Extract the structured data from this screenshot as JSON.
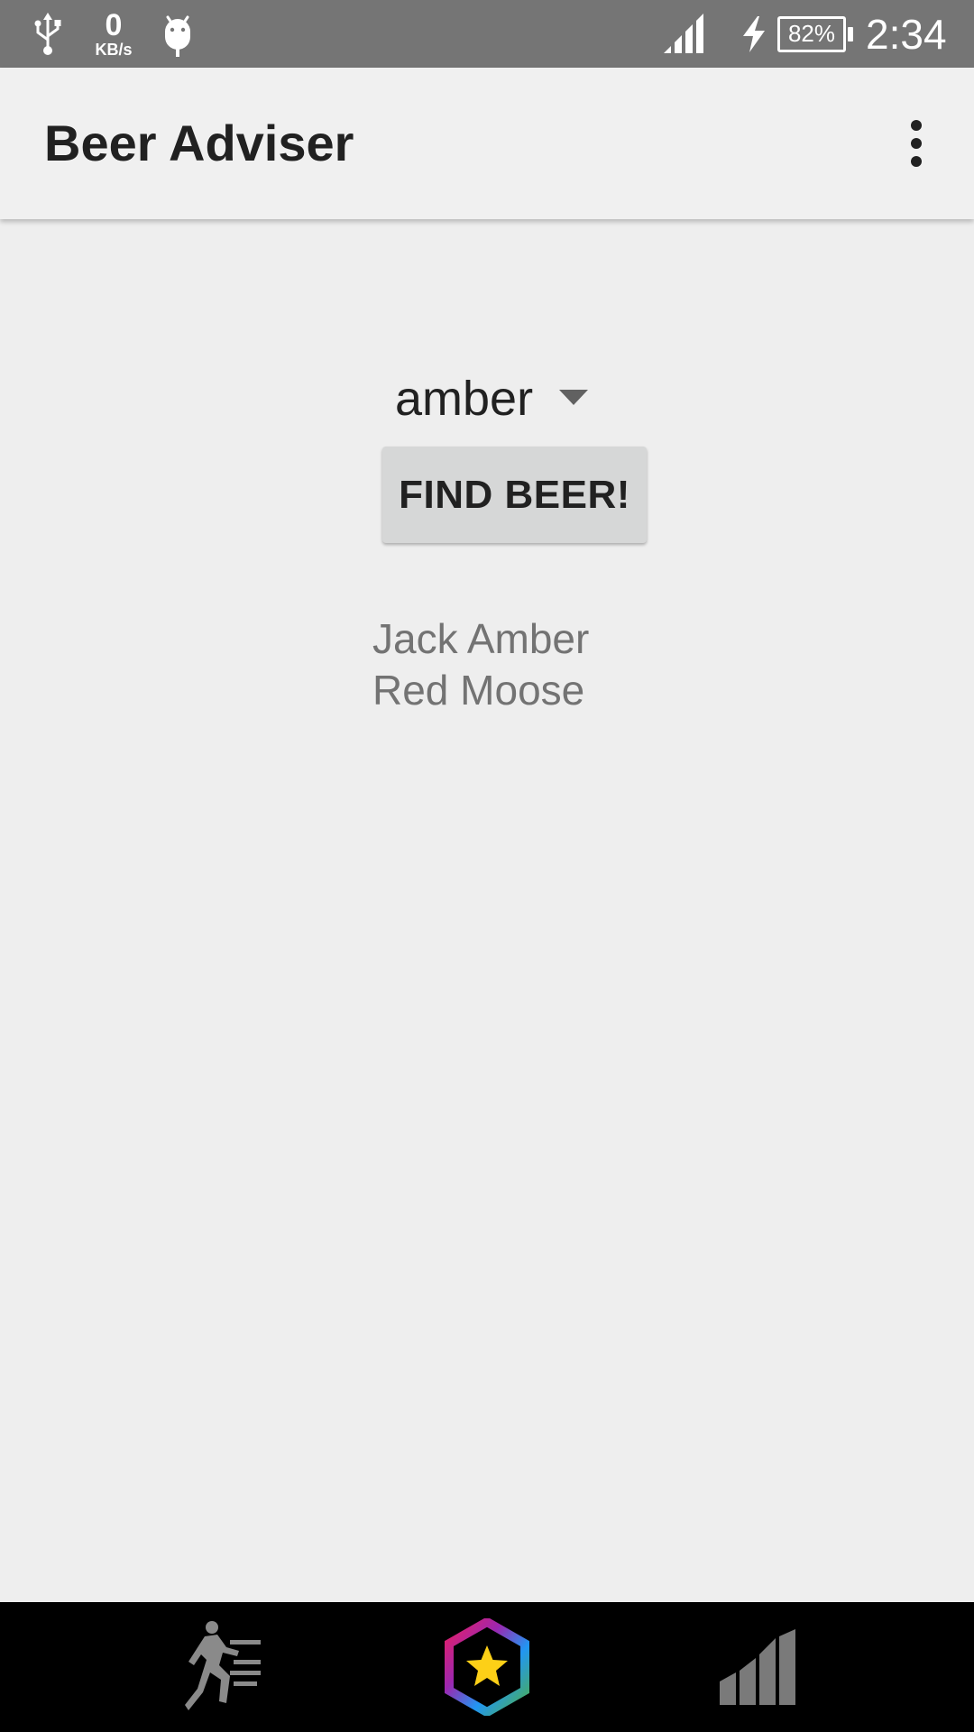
{
  "status_bar": {
    "net_speed_value": "0",
    "net_speed_unit": "KB/s",
    "battery_percent": "82%",
    "time": "2:34",
    "icons": [
      "usb-icon",
      "android-debug-icon",
      "signal-icon",
      "charging-icon",
      "battery-icon"
    ]
  },
  "app_bar": {
    "title": "Beer Adviser",
    "menu_icon": "more-vert-icon"
  },
  "form": {
    "color_spinner_value": "amber",
    "find_button_label": "FIND BEER!"
  },
  "results": {
    "items": [
      "Jack Amber",
      "Red Moose"
    ]
  },
  "bottom_bar": {
    "icons": [
      "running-icon",
      "star-hexagon-icon",
      "bar-chart-icon"
    ]
  },
  "colors": {
    "status_bar": "#757575",
    "app_bar": "#f0f0f0",
    "background": "#eeeeee",
    "button": "#d6d7d7",
    "result_text": "#737373",
    "bottom_bar": "#000000",
    "star": "#fdd017"
  }
}
